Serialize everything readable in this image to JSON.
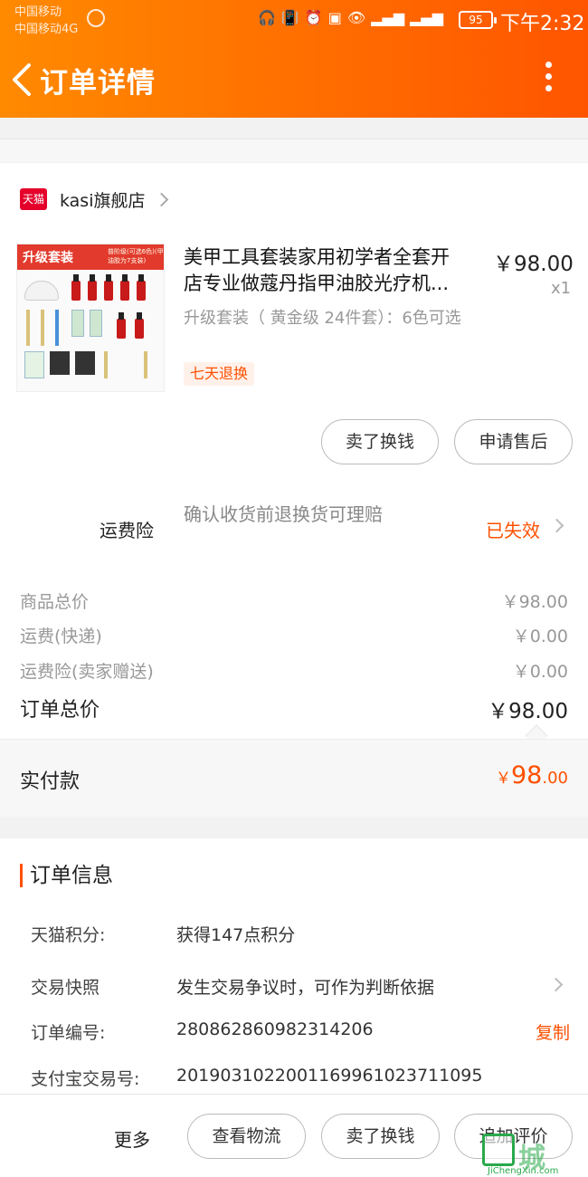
{
  "status_bar": {
    "carrier_1": "中国移动",
    "carrier_2": "中国移动4G",
    "battery": "95",
    "time": "下午2:32",
    "icons": [
      "headphones-icon",
      "vibrate-icon",
      "alarm-icon",
      "hd-icon",
      "eye-icon",
      "signal-e-icon",
      "signal-4g-icon"
    ]
  },
  "header": {
    "title": "订单详情",
    "back_icon": "chevron-left-icon",
    "menu_icon": "more-vertical-icon"
  },
  "shop": {
    "logo_text": "天猫",
    "name": "kasi旗舰店"
  },
  "product": {
    "image_band_text": "升级套装",
    "image_band_note": "普阶级(可选6色)(甲油胶为7支装)",
    "title_line1": "美甲工具套装家用初学者全套开",
    "title_line2": "店专业做蔻丹指甲油胶光疗机...",
    "price": "￥98.00",
    "qty": "x1",
    "spec": "升级套装（ 黄金级 24件套）：6色可选",
    "badge": "七天退换"
  },
  "buttons": {
    "sell": "卖了换钱",
    "after_sale": "申请售后"
  },
  "insurance": {
    "label": "运费险",
    "desc": "确认收货前退换货可理赔",
    "status": "已失效"
  },
  "fees": [
    {
      "label": "商品总价",
      "value": "￥98.00"
    },
    {
      "label": "运费(快递)",
      "value": "￥0.00"
    },
    {
      "label": "运费险(卖家赠送)",
      "value": "￥0.00"
    }
  ],
  "total": {
    "label": "订单总价",
    "value": "￥98.00"
  },
  "paid": {
    "label": "实付款",
    "currency": "￥",
    "integer": "98",
    "decimal": ".00"
  },
  "order_info": {
    "heading": "订单信息",
    "rows": [
      {
        "key": "天猫积分:",
        "value": "获得147点积分"
      },
      {
        "key": "交易快照",
        "value": "发生交易争议时，可作为判断依据"
      },
      {
        "key": "订单编号:",
        "value": "280862860982314206",
        "action": "复制"
      },
      {
        "key": "支付宝交易号:",
        "value": "2019031022001169961023711095"
      }
    ]
  },
  "bottom_bar": {
    "more": "更多",
    "btn_logistics": "查看物流",
    "btn_sell": "卖了换钱",
    "btn_review": "追加评价"
  },
  "watermark": {
    "text": "城",
    "url": "JiChengXin.com"
  },
  "colors": {
    "accent": "#ff5000",
    "header_start": "#ff8a00",
    "header_end": "#ff5500",
    "tmall_red": "#e4002b"
  }
}
